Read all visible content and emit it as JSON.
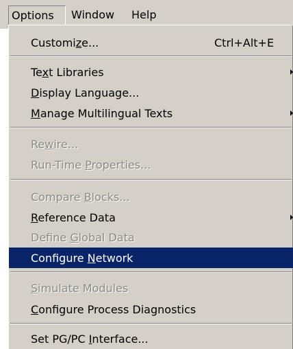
{
  "menubar": {
    "items": [
      "Options",
      "Window",
      "Help"
    ]
  },
  "menu": {
    "items": [
      {
        "pre": "Customi",
        "acc": "z",
        "post": "e...",
        "shortcut": "Ctrl+Alt+E"
      },
      {
        "pre": "Te",
        "acc": "x",
        "post": "t Libraries"
      },
      {
        "pre": "",
        "acc": "D",
        "post": "isplay Language..."
      },
      {
        "pre": "",
        "acc": "M",
        "post": "anage Multilingual Texts"
      },
      {
        "pre": "Re",
        "acc": "w",
        "post": "ire..."
      },
      {
        "pre": "Run-Time ",
        "acc": "P",
        "post": "roperties..."
      },
      {
        "pre": "Compare ",
        "acc": "B",
        "post": "locks..."
      },
      {
        "pre": "",
        "acc": "R",
        "post": "eference Data"
      },
      {
        "pre": "Define ",
        "acc": "G",
        "post": "lobal Data"
      },
      {
        "pre": "Configure ",
        "acc": "N",
        "post": "etwork"
      },
      {
        "pre": "",
        "acc": "S",
        "post": "imulate Modules"
      },
      {
        "pre": "",
        "acc": "C",
        "post": "onfigure Process Diagnostics"
      },
      {
        "pre": "Set PG/PC ",
        "acc": "I",
        "post": "nterface..."
      }
    ]
  },
  "colors": {
    "menu_bg": "#d4d0c8",
    "highlight": "#0a246a",
    "disabled_text": "#8c8a84"
  }
}
